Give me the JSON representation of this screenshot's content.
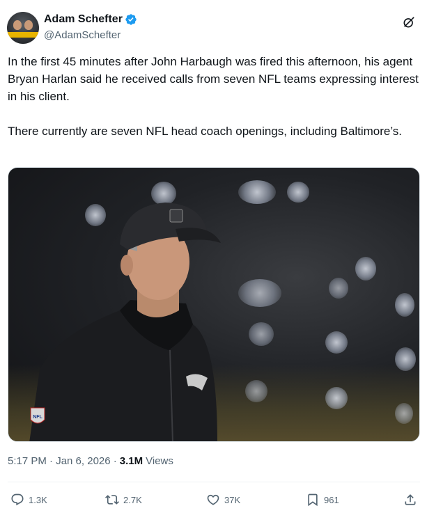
{
  "author": {
    "display_name": "Adam Schefter",
    "handle": "@AdamSchefter",
    "verified": true
  },
  "tweet": {
    "paragraphs": [
      "In the first 45 minutes after John Harbaugh was fired this afternoon, his agent Bryan Harlan said he received calls from seven NFL teams expressing interest in his client.",
      "There currently are seven NFL head coach openings, including Baltimore’s."
    ]
  },
  "media": {
    "icons": [
      "cap-logo",
      "ravens-logo",
      "nfl-shield-logo"
    ],
    "badge_text": "NFL"
  },
  "meta": {
    "timestamp": "5:17 PM · Jan 6, 2026 ·",
    "views_count": "3.1M",
    "views_label": "Views"
  },
  "actions": {
    "reply_count": "1.3K",
    "retweet_count": "2.7K",
    "like_count": "37K",
    "bookmark_count": "961"
  },
  "colors": {
    "text_primary": "#0f1419",
    "text_secondary": "#536471",
    "verified_blue": "#1d9bf0",
    "divider": "#eff3f4"
  }
}
